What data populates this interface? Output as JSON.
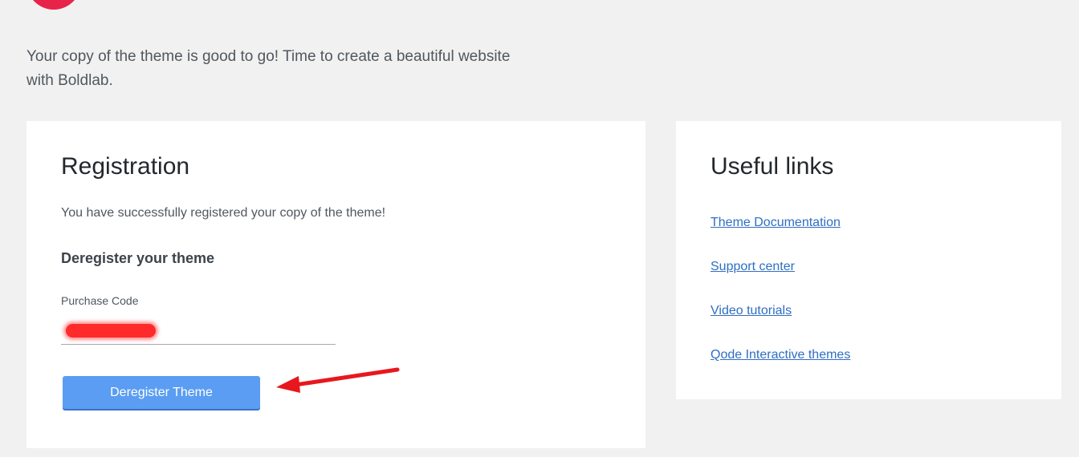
{
  "intro": {
    "line1": "Your copy of the theme is good to go! Time to create a beautiful website",
    "line2": "with Boldlab."
  },
  "registration": {
    "title": "Registration",
    "success_message": "You have successfully registered your copy of the theme!",
    "deregister_heading": "Deregister your theme",
    "purchase_code_label": "Purchase Code",
    "deregister_button_label": "Deregister Theme"
  },
  "useful_links": {
    "title": "Useful links",
    "links": [
      {
        "label": "Theme Documentation"
      },
      {
        "label": "Support center"
      },
      {
        "label": "Video tutorials"
      },
      {
        "label": "Qode Interactive themes"
      }
    ]
  },
  "colors": {
    "background": "#f1f1f1",
    "card": "#ffffff",
    "button": "#5b9df2",
    "link": "#2f6ec3",
    "logo": "#e8234a",
    "annotation_arrow": "#e8171d"
  },
  "icons": {
    "logo": "boldlab-logo-icon",
    "annotation": "red-arrow-icon"
  }
}
